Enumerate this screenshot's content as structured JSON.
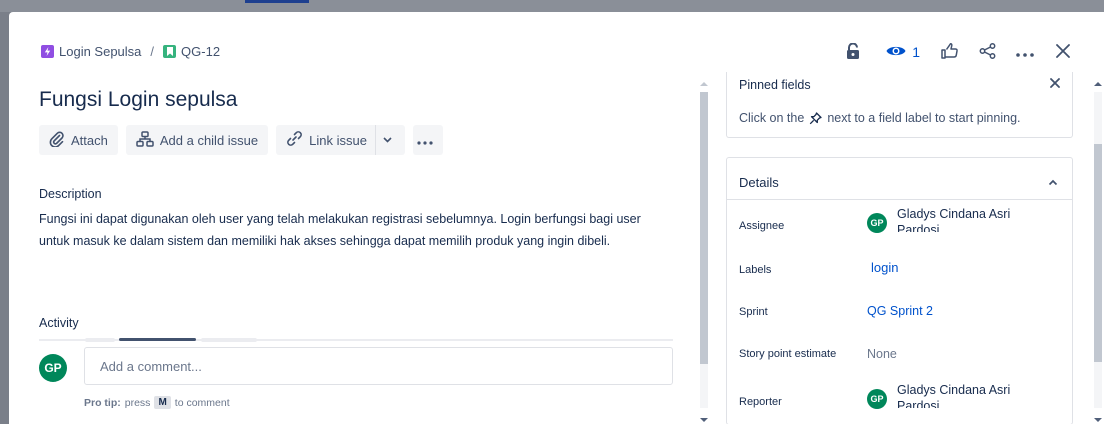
{
  "breadcrumb": {
    "parent": "Login Sepulsa",
    "separator": "/",
    "current": "QG-12"
  },
  "header": {
    "watch_count": "1"
  },
  "issue": {
    "title": "Fungsi Login sepulsa"
  },
  "toolbar": {
    "attach_label": "Attach",
    "add_child_label": "Add a child issue",
    "link_issue_label": "Link issue"
  },
  "description": {
    "label": "Description",
    "text": "Fungsi ini dapat digunakan oleh user yang telah melakukan registrasi sebelumnya. Login berfungsi bagi user untuk masuk ke dalam sistem dan memiliki hak akses sehingga dapat memilih  produk yang ingin dibeli."
  },
  "activity": {
    "label": "Activity",
    "avatar_initials": "GP",
    "comment_placeholder": "Add a comment...",
    "pro_tip_bold": "Pro tip:",
    "pro_tip_press": "press",
    "pro_tip_key": "M",
    "pro_tip_end": "to comment"
  },
  "pinned": {
    "title": "Pinned fields",
    "text_before": "Click on the",
    "text_after": "next to a field label to start pinning."
  },
  "details": {
    "title": "Details",
    "rows": [
      {
        "label": "Assignee",
        "value": "Gladys Cindana Asri Pardosi",
        "initials": "GP"
      },
      {
        "label": "Labels",
        "value": "login"
      },
      {
        "label": "Sprint",
        "value": "QG Sprint 2"
      },
      {
        "label": "Story point estimate",
        "value": "None"
      },
      {
        "label": "Reporter",
        "value": "Gladys Cindana Asri Pardosi",
        "initials": "GP"
      }
    ]
  },
  "colors": {
    "accent": "#0052cc",
    "avatar": "#00875a",
    "epic": "#904ee2",
    "story": "#36b37e"
  }
}
